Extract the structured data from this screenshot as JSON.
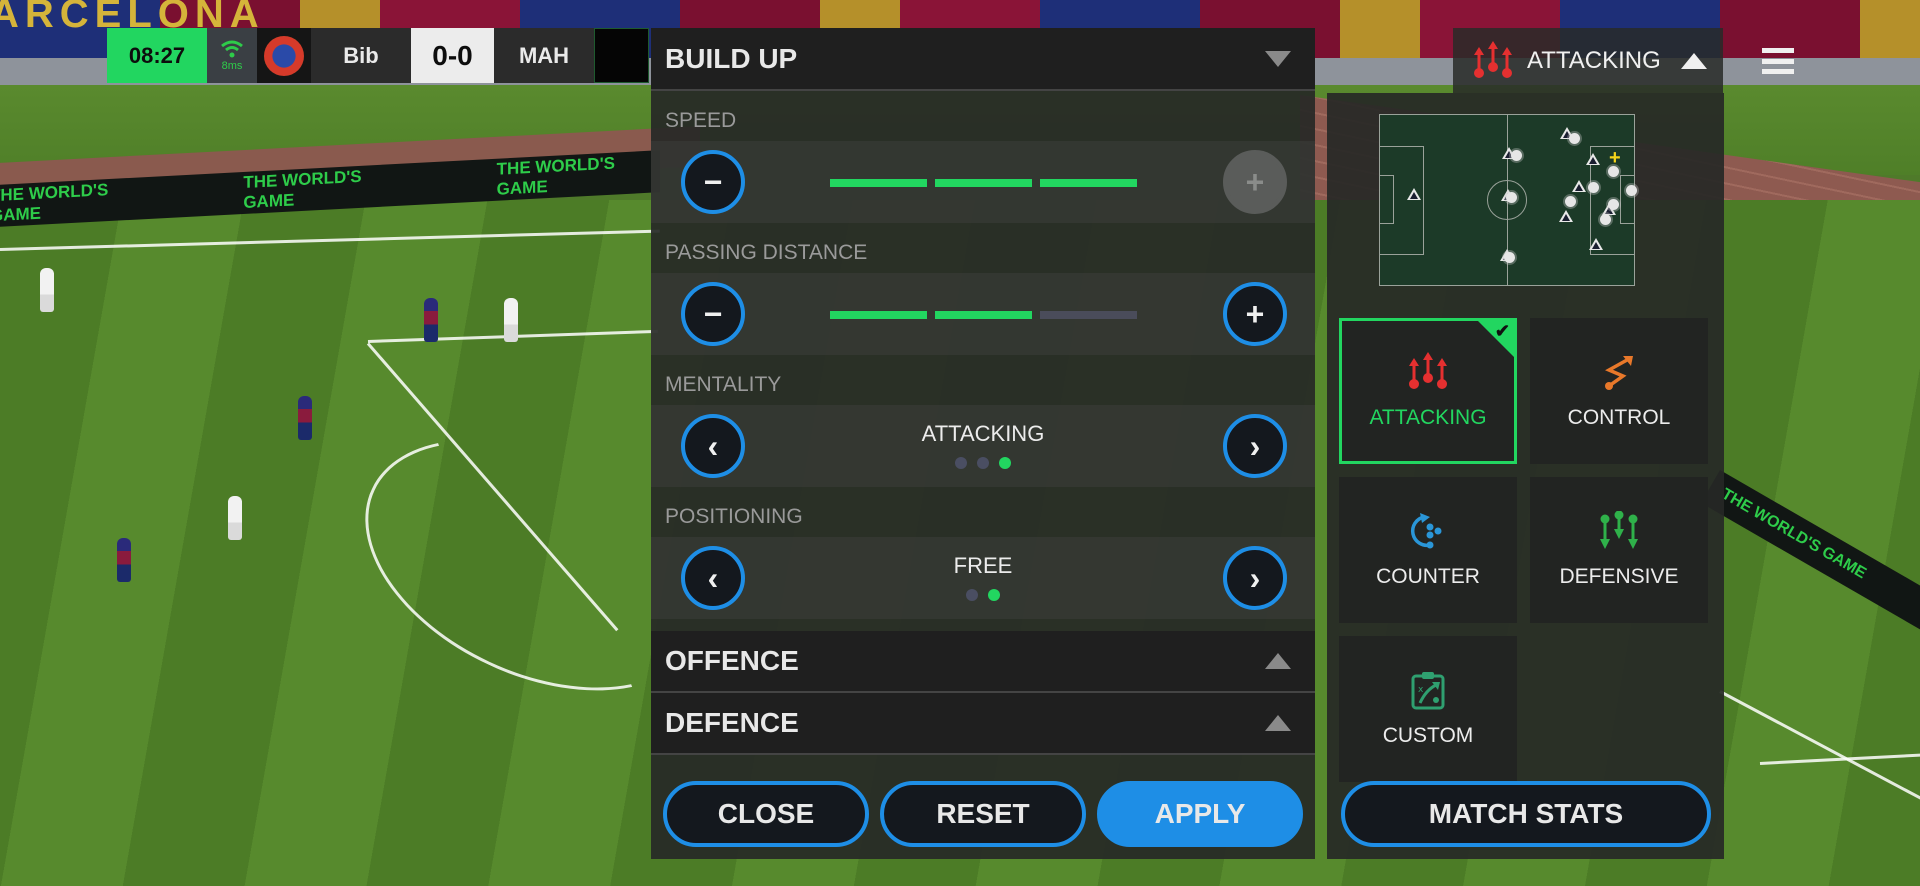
{
  "scoreboard": {
    "clock": "08:27",
    "ping": "8ms",
    "home_team": "Bib",
    "score": "0-0",
    "away_team": "MAH"
  },
  "background": {
    "stand_banner": "ARCELONA",
    "ad_text": "THE WORLD'S GAME"
  },
  "build_up": {
    "title": "BUILD UP",
    "speed": {
      "label": "SPEED",
      "level": 3,
      "max": 3,
      "minus_enabled": true,
      "plus_enabled": false
    },
    "passing_distance": {
      "label": "PASSING DISTANCE",
      "level": 2,
      "max": 3,
      "minus_enabled": true,
      "plus_enabled": true
    },
    "mentality": {
      "label": "MENTALITY",
      "value": "ATTACKING",
      "index": 3,
      "count": 3
    },
    "positioning": {
      "label": "POSITIONING",
      "value": "FREE",
      "index": 2,
      "count": 2
    }
  },
  "sections": {
    "offence": "OFFENCE",
    "defence": "DEFENCE"
  },
  "actions": {
    "close": "CLOSE",
    "reset": "RESET",
    "apply": "APPLY"
  },
  "tactic_header": {
    "current": "ATTACKING"
  },
  "tactics": [
    {
      "label": "ATTACKING",
      "icon": "attacking-icon",
      "color": "#e53030",
      "selected": true
    },
    {
      "label": "CONTROL",
      "icon": "control-icon",
      "color": "#e8782a",
      "selected": false
    },
    {
      "label": "COUNTER",
      "icon": "counter-icon",
      "color": "#2a96d8",
      "selected": false
    },
    {
      "label": "DEFENSIVE",
      "icon": "defensive-icon",
      "color": "#2fb14a",
      "selected": false
    },
    {
      "label": "CUSTOM",
      "icon": "clipboard-tactics-icon",
      "color": "#2fa070",
      "selected": false
    }
  ],
  "match_stats": "MATCH STATS",
  "colors": {
    "accent_green": "#22d660",
    "accent_blue": "#1e8ee6",
    "panel_dark": "#1f1f1f"
  }
}
